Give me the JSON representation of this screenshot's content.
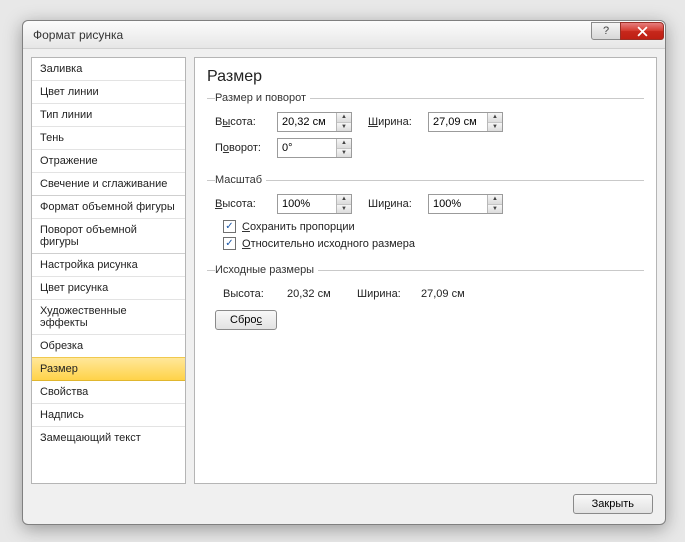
{
  "window": {
    "title": "Формат рисунка"
  },
  "sidebar": {
    "items": [
      "Заливка",
      "Цвет линии",
      "Тип линии",
      "Тень",
      "Отражение",
      "Свечение и сглаживание",
      "Формат объемной фигуры",
      "Поворот объемной фигуры",
      "Настройка рисунка",
      "Цвет рисунка",
      "Художественные эффекты",
      "Обрезка",
      "Размер",
      "Свойства",
      "Надпись",
      "Замещающий текст"
    ],
    "selected": 12
  },
  "content": {
    "heading": "Размер",
    "group_size": {
      "legend": "Размер и поворот",
      "height_label": "Высота:",
      "height_value": "20,32 см",
      "width_label": "Ширина:",
      "width_value": "27,09 см",
      "rotation_label": "Поворот:",
      "rotation_value": "0°"
    },
    "group_scale": {
      "legend": "Масштаб",
      "height_label": "Высота:",
      "height_value": "100%",
      "width_label": "Ширина:",
      "width_value": "100%",
      "lock_aspect": "Сохранить пропорции",
      "rel_original": "Относительно исходного размера"
    },
    "group_orig": {
      "legend": "Исходные размеры",
      "height_label": "Высота:",
      "height_value": "20,32 см",
      "width_label": "Ширина:",
      "width_value": "27,09 см",
      "reset_label": "Сброс"
    }
  },
  "footer": {
    "close_label": "Закрыть"
  }
}
